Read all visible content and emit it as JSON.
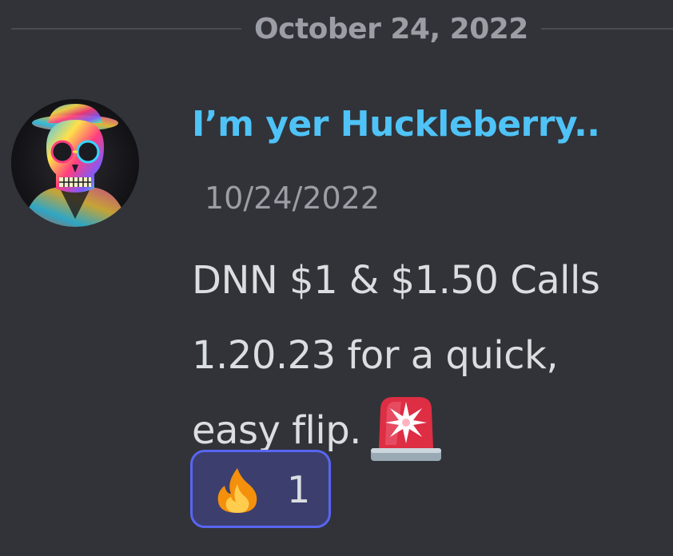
{
  "divider": {
    "date": "October 24, 2022"
  },
  "message": {
    "username": "I’m yer Huckleberry..",
    "timestamp": "10/24/2022",
    "text_lines": [
      "DNN $1 & $1.50 Calls",
      "1.20.23 for a quick,",
      "easy flip."
    ],
    "inline_emoji": "rotating-light-icon"
  },
  "reaction": {
    "emoji": "fire-icon",
    "count": "1"
  },
  "colors": {
    "background": "#313338",
    "username": "#4fc3f7",
    "reaction_border": "#5865f2",
    "reaction_bg": "#3c3f6e"
  }
}
